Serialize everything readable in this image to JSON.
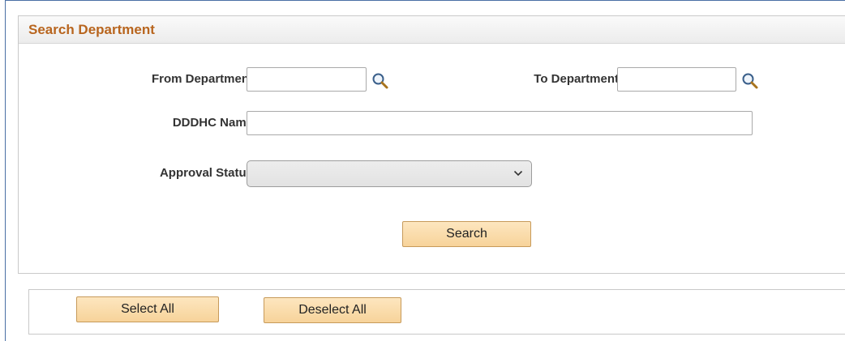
{
  "search_panel": {
    "title": "Search Department",
    "from_department": {
      "label": "From Department",
      "value": ""
    },
    "to_department": {
      "label": "To Department",
      "value": ""
    },
    "dddhc_name": {
      "label": "DDDHC Name",
      "value": ""
    },
    "approval_status": {
      "label": "Approval Status",
      "selected": ""
    },
    "search_button": "Search"
  },
  "actions": {
    "select_all": "Select All",
    "deselect_all": "Deselect All"
  },
  "icons": {
    "lookup": "magnifier-icon",
    "dropdown": "chevron-down-icon"
  },
  "colors": {
    "title": "#b8651e",
    "button_fill": "#f9dba8",
    "button_border": "#c79a5a",
    "frame_border": "#4a6fa5"
  }
}
